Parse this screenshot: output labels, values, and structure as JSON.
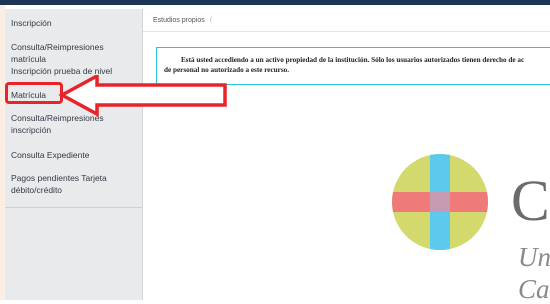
{
  "sidebar": {
    "items": [
      {
        "label": "Inscripción"
      },
      {
        "label": "Consulta/Reimpresiones matrícula"
      },
      {
        "label": "Inscripción prueba de nivel"
      },
      {
        "label": "Matrícula"
      },
      {
        "label": "Consulta/Reimpresiones inscripción"
      },
      {
        "label": "Consulta Expediente"
      },
      {
        "label": "Pagos pendientes Tarjeta débito/crédito"
      }
    ]
  },
  "breadcrumb": {
    "item": "Estudios propios",
    "separator": "/"
  },
  "notice": {
    "line1": "Está usted accediendo a un activo propiedad de la institución. Sólo los usuarios autorizados tienen derecho de ac",
    "line2": "de personal no autorizado a este recurso."
  },
  "logo": {
    "icon": "university-cross-logo",
    "text_line1": "C",
    "text_line2": "Un",
    "text_line3": "Ca",
    "colors": {
      "yellow": "#d3d96c",
      "red": "#ef7a7a",
      "blue": "#5dcaed",
      "center": "#c79ab3"
    }
  },
  "annotation": {
    "color": "#e8232a",
    "highlight_target": "Matrícula"
  }
}
